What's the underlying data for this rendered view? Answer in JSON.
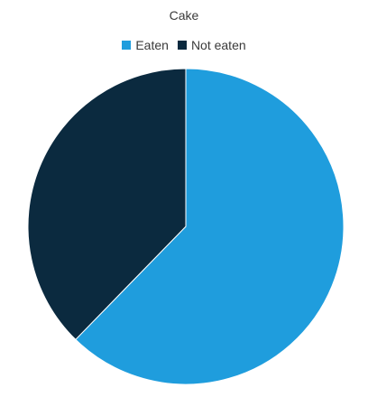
{
  "chart_data": {
    "type": "pie",
    "title": "Cake",
    "categories": [
      "Eaten",
      "Not eaten"
    ],
    "values": [
      62.3,
      37.7
    ],
    "colors": [
      "#1f9ddd",
      "#0b2a3f"
    ],
    "legend_position": "top",
    "start_angle_deg": 0,
    "direction": "clockwise",
    "slice_border_color": "#ffffff"
  }
}
